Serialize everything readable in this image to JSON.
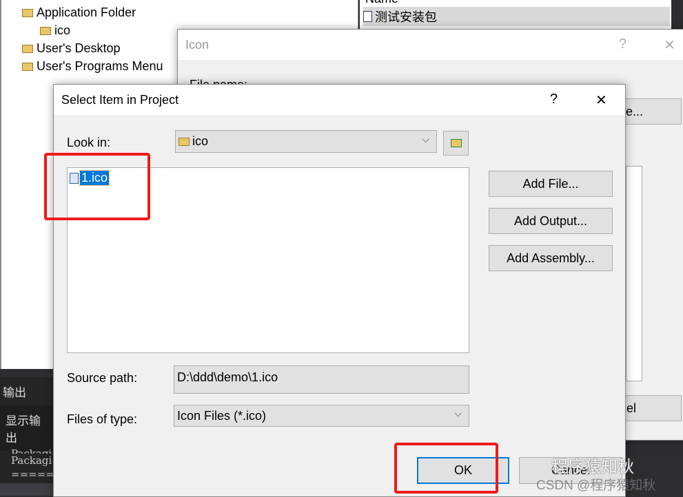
{
  "tree": {
    "items": [
      {
        "label": "Application Folder"
      },
      {
        "label": "ico"
      },
      {
        "label": "User's Desktop"
      },
      {
        "label": "User's Programs Menu"
      }
    ]
  },
  "file_list": {
    "header": "Name",
    "rows": [
      "测试安装包"
    ]
  },
  "output_panel": {
    "title": "输出",
    "show_output_label": "显示输出",
    "lines": [
      "Packagi",
      "Packagi",
      "======="
    ]
  },
  "icon_dialog": {
    "title": "Icon",
    "help": "?",
    "close": "✕",
    "file_name_label": "File name:",
    "browse_label": "e...",
    "cancel_label": "el"
  },
  "select_dialog": {
    "title": "Select Item in Project",
    "help": "?",
    "close": "✕",
    "look_in_label": "Look in:",
    "look_in_value": "ico",
    "items": [
      "1.ico"
    ],
    "add_file": "Add File...",
    "add_output": "Add Output...",
    "add_assembly": "Add Assembly...",
    "source_path_label": "Source path:",
    "source_path_value": "D:\\ddd\\demo\\1.ico",
    "files_of_type_label": "Files of type:",
    "files_of_type_value": "Icon Files (*.ico)",
    "ok": "OK",
    "cancel": "Cancel"
  },
  "watermark": {
    "line1": "程序猿知秋",
    "line2": "CSDN @程序猿知秋"
  },
  "colors": {
    "selection": "#0078d7",
    "annotation": "#f01a1a"
  }
}
